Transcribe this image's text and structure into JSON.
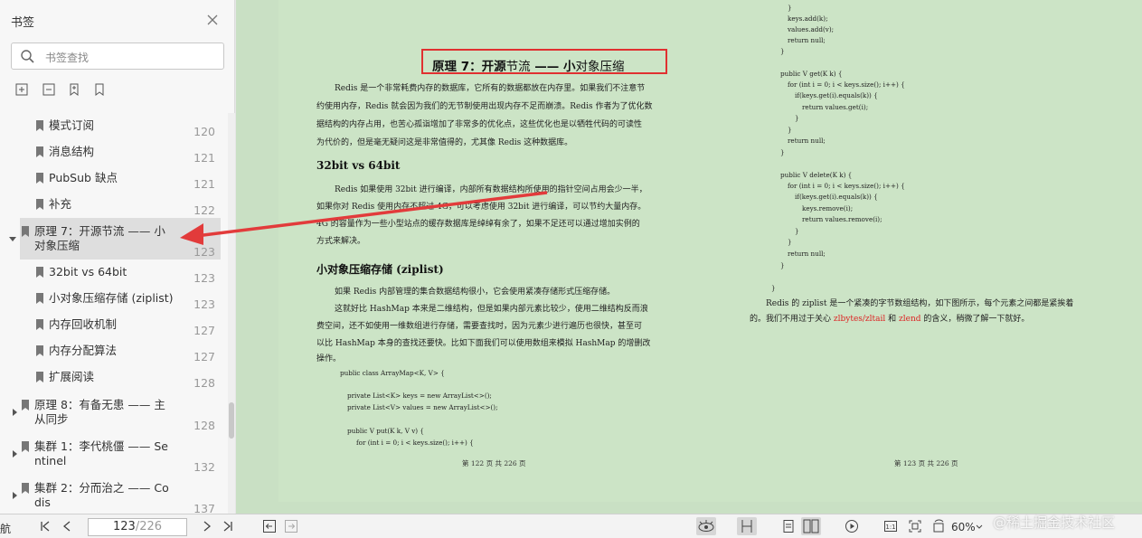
{
  "sidebar": {
    "title": "书签",
    "search_placeholder": "书签查找",
    "items": [
      {
        "label": "模式订阅",
        "page": "120"
      },
      {
        "label": "消息结构",
        "page": "121"
      },
      {
        "label": "PubSub 缺点",
        "page": "121"
      },
      {
        "label": "补充",
        "page": "122"
      },
      {
        "label": "原理 7：开源节流 —— 小",
        "label2": "对象压缩",
        "page": "123"
      },
      {
        "label": "32bit vs 64bit",
        "page": "123"
      },
      {
        "label": "小对象压缩存储 (ziplist)",
        "page": "123"
      },
      {
        "label": "内存回收机制",
        "page": "127"
      },
      {
        "label": "内存分配算法",
        "page": "127"
      },
      {
        "label": "扩展阅读",
        "page": "128"
      },
      {
        "label": "原理 8：有备无患 —— 主",
        "label2": "从同步",
        "page": "128"
      },
      {
        "label": "集群 1：李代桃僵 —— Se",
        "label2": "ntinel",
        "page": "132"
      },
      {
        "label": "集群 2：分而治之 —— Co",
        "label2": "dis",
        "page": "137"
      }
    ]
  },
  "page_left": {
    "title_a": "原理 7：开源",
    "title_b": "节流",
    "title_c": " —— ",
    "title_d": "小",
    "title_e": "对象压缩",
    "p1": [
      "Redis 是一个非常耗费内存的数据库，它所有的数据都放在内存里。如果我们不注意节",
      "约使用内存，Redis 就会因为我们的无节制使用出现内存不足而崩溃。Redis 作者为了优化数",
      "据结构的内存占用，也苦心孤诣增加了非常多的优化点，这些优化也是以牺牲代码的可读性",
      "为代价的，但是毫无疑问这是非常值得的，尤其像 Redis 这种数据库。"
    ],
    "h_32": "32bit vs 64bit",
    "p2": [
      "Redis 如果使用 32bit 进行编译，内部所有数据结构所使用的指针空间占用会少一半，",
      "如果你对 Redis 使用内存不超过 4G，可以考虑使用 32bit 进行编译，可以节约大量内存。",
      "4G 的容量作为一些小型站点的缓存数据库是绰绰有余了，如果不足还可以通过增加实例的",
      "方式来解决。"
    ],
    "h_zip": "小对象压缩存储 (ziplist)",
    "p3": [
      "如果 Redis 内部管理的集合数据结构很小，它会使用紧凑存储形式压缩存储。",
      "这就好比 HashMap 本来是二维结构，但是如果内部元素比较少，使用二维结构反而浪",
      "费空间，还不如使用一维数组进行存储，需要查找时，因为元素少进行遍历也很快，甚至可",
      "以比 HashMap 本身的查找还要快。比如下面我们可以使用数组来模拟 HashMap 的增删改",
      "操作。"
    ],
    "code": [
      "public class ArrayMap<K, V> {",
      "",
      "    private List<K> keys = new ArrayList<>();",
      "    private List<V> values = new ArrayList<>();",
      "",
      "    public V put(K k, V v) {",
      "        for (int i = 0; i < keys.size(); i++) {"
    ],
    "footer": "第 122 页 共 226 页"
  },
  "page_right": {
    "code": [
      "        }",
      "        keys.add(k);",
      "        values.add(v);",
      "        return null;",
      "    }",
      "",
      "    public V get(K k) {",
      "        for (int i = 0; i < keys.size(); i++) {",
      "            if(keys.get(i).equals(k)) {",
      "                return values.get(i);",
      "            }",
      "        }",
      "        return null;",
      "    }",
      "",
      "    public V delete(K k) {",
      "        for (int i = 0; i < keys.size(); i++) {",
      "            if(keys.get(i).equals(k)) {",
      "                keys.remove(i);",
      "                return values.remove(i);",
      "            }",
      "        }",
      "        return null;",
      "    }",
      "",
      "}"
    ],
    "p1a": "Redis 的 ziplist 是一个紧凑的字节数组结构，如下图所示，每个元素之间都是紧挨着",
    "p2a": "的。我们不用过于关心 ",
    "p2b": "zlbytes/zltail",
    "p2c": " 和 ",
    "p2d": "zlend",
    "p2e": " 的含义，稍微了解一下就好。",
    "footer": "第 123 页 共 226 页"
  },
  "bottombar": {
    "nav_label": "航",
    "page_current": "123",
    "page_total": "/226",
    "zoom": "60%",
    "watermark": "@稀土掘金技术社区"
  },
  "colors": {
    "highlight_box": "#e03030",
    "arrow": "#e23b3b",
    "page_bg": "#cce4c6"
  }
}
